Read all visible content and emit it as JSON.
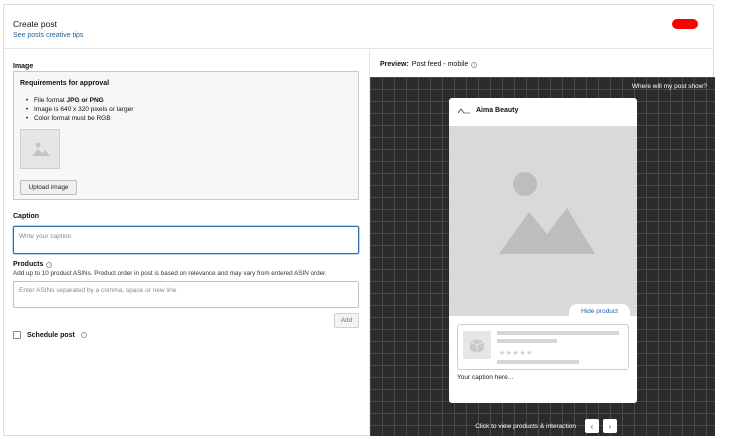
{
  "header": {
    "title": "Create post",
    "tips_link": "See posts creative tips",
    "accent_color": "#ff0000"
  },
  "image_section": {
    "label": "Image",
    "requirements_title": "Requirements for approval",
    "requirements": [
      {
        "prefix": "File format ",
        "bold": "JPG or PNG"
      },
      {
        "prefix": "Image is 640 x 320 pixels or larger",
        "bold": ""
      },
      {
        "prefix": "Color format must be RGB",
        "bold": ""
      }
    ],
    "upload_label": "Upload image"
  },
  "caption_section": {
    "label": "Caption",
    "placeholder": "Write your caption"
  },
  "products_section": {
    "label": "Products",
    "help": "Add up to 10 product ASINs. Product order in post is based on relevance and may vary from entered ASIN order.",
    "placeholder": "Enter ASINs separated by a comma, space or new line",
    "add_label": "Add"
  },
  "schedule": {
    "label": "Schedule post"
  },
  "preview": {
    "label_bold": "Preview:",
    "label_value": "Post feed - mobile",
    "where_link": "Where will my post show?",
    "brand": "Aima Beauty",
    "hide_product": "Hide product",
    "caption": "Your caption here...",
    "bottom_text": "Click to view products & interaction",
    "prev_arrow": "‹",
    "next_arrow": "›"
  }
}
